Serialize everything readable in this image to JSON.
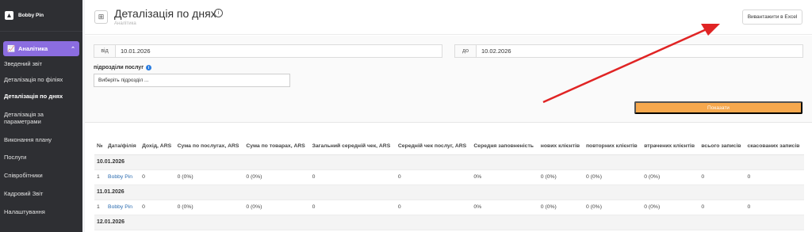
{
  "brand": {
    "name": "Bobby Pin"
  },
  "sidebar": {
    "section_label": "Аналітика",
    "items": [
      {
        "label": "Зведений звіт",
        "active": false
      },
      {
        "label": "Деталізація по філіях",
        "active": false
      },
      {
        "label": "Деталізація по днях",
        "active": true
      },
      {
        "label": "Деталізація за параметрами",
        "active": false
      },
      {
        "label": "Виконання плану",
        "active": false
      },
      {
        "label": "Послуги",
        "active": false
      },
      {
        "label": "Співробітники",
        "active": false
      },
      {
        "label": "Кадровий Звіт",
        "active": false
      },
      {
        "label": "Налаштування",
        "active": false
      }
    ]
  },
  "header": {
    "title": "Деталізація по днях",
    "subtitle": "Аналітика",
    "export_label": "Вивантажити в Excel"
  },
  "filters": {
    "from_label": "від",
    "from_value": "10.01.2026",
    "to_label": "до",
    "to_value": "10.02.2026",
    "subdivisions_label": "підрозділи послуг",
    "subdivisions_placeholder": "Виберіть підрозділ ...",
    "show_label": "Показати"
  },
  "table": {
    "columns": [
      "№",
      "Дата/філія",
      "Дохід, ARS",
      "Сума по послугах, ARS",
      "Сума по товарах, ARS",
      "Загальний середній чек, ARS",
      "Середній чек послуг, ARS",
      "Середня заповненість",
      "нових клієнтів",
      "повторних клієнтів",
      "втрачених клієнтів",
      "всього записів",
      "скасованих записів"
    ],
    "groups": [
      {
        "date": "10.01.2026",
        "rows": [
          [
            "1",
            "Bobby Pin",
            "0",
            "0 (0%)",
            "0 (0%)",
            "0",
            "0",
            "0%",
            "0 (0%)",
            "0 (0%)",
            "0 (0%)",
            "0",
            "0"
          ]
        ]
      },
      {
        "date": "11.01.2026",
        "rows": [
          [
            "1",
            "Bobby Pin",
            "0",
            "0 (0%)",
            "0 (0%)",
            "0",
            "0",
            "0%",
            "0 (0%)",
            "0 (0%)",
            "0 (0%)",
            "0",
            "0"
          ]
        ]
      },
      {
        "date": "12.01.2026",
        "rows": []
      }
    ]
  },
  "colors": {
    "accent": "#8b6de0",
    "button": "#f6a84d",
    "arrow": "#e02424",
    "sidebar_bg": "#2e2f33"
  }
}
